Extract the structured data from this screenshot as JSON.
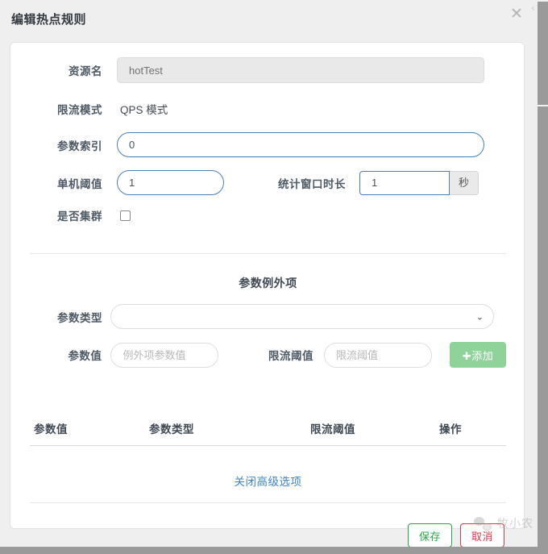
{
  "modal": {
    "title": "编辑热点规则",
    "close_icon": "close-icon",
    "close_glyph": "✕"
  },
  "form": {
    "resource": {
      "label": "资源名",
      "value": "hotTest",
      "readonly": true
    },
    "flow_mode": {
      "label": "限流模式",
      "value": "QPS 模式"
    },
    "param_index": {
      "label": "参数索引",
      "value": "0"
    },
    "threshold": {
      "label": "单机阈值",
      "value": "1"
    },
    "window": {
      "label": "统计窗口时长",
      "value": "1",
      "unit": "秒"
    },
    "cluster": {
      "label": "是否集群",
      "checked": false
    }
  },
  "exception_section": {
    "title": "参数例外项",
    "param_type": {
      "label": "参数类型",
      "value": "",
      "options": [
        ""
      ],
      "chevron_glyph": "⌄"
    },
    "param_value": {
      "label": "参数值",
      "value": "",
      "placeholder": "例外项参数值"
    },
    "limit_threshold": {
      "label": "限流阈值",
      "value": "",
      "placeholder": "限流阈值"
    },
    "add_button": {
      "label": "添加",
      "plus_glyph": "✚"
    }
  },
  "table": {
    "columns": [
      "参数值",
      "参数类型",
      "限流阈值",
      "操作"
    ],
    "rows": []
  },
  "advanced_link": {
    "label": "关闭高级选项"
  },
  "footer": {
    "save_label": "保存",
    "cancel_label": "取消"
  },
  "watermark": {
    "text": "牧小农",
    "icon": "wechat-icon"
  },
  "chrome": {
    "back_chevron_glyph": "‹"
  },
  "colors": {
    "page_bg": "#efeff0",
    "card_bg": "#ffffff",
    "label": "#4e5a66",
    "input_focus_border": "#4a7fb5",
    "link": "#3d83c9",
    "add_button": "#8fd39a",
    "save_border": "#27a745",
    "cancel_border": "#dc3848",
    "scrollbar_thumb": "#9a9a9a"
  }
}
